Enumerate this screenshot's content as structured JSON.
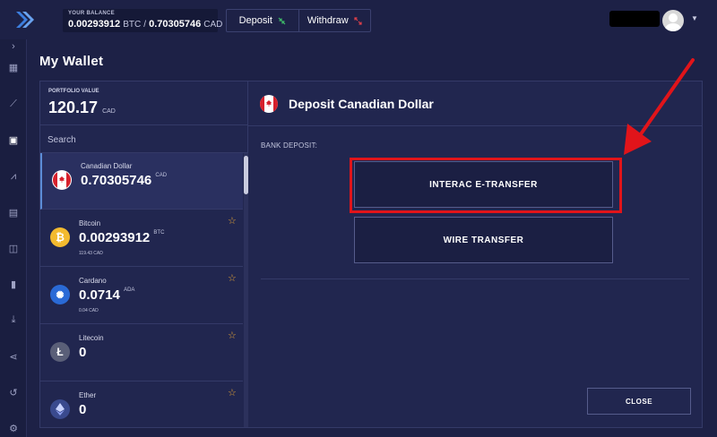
{
  "header": {
    "balance_caption": "YOUR BALANCE",
    "balance_btc": "0.00293912",
    "balance_btc_unit": "BTC",
    "balance_sep": "/",
    "balance_cad": "0.70305746",
    "balance_cad_unit": "CAD",
    "deposit_label": "Deposit",
    "withdraw_label": "Withdraw"
  },
  "page": {
    "title": "My Wallet"
  },
  "portfolio": {
    "caption": "PORTFOLIO VALUE",
    "value": "120.17",
    "unit": "CAD",
    "search_placeholder": "Search"
  },
  "wallets": [
    {
      "name": "Canadian Dollar",
      "balance": "0.70305746",
      "unit": "CAD",
      "sub": "",
      "coin_color": "#ffffff",
      "icon": "canada-flag-icon"
    },
    {
      "name": "Bitcoin",
      "balance": "0.00293912",
      "unit": "BTC",
      "sub": "119.43 CAD",
      "coin_color": "#f3ba2f",
      "icon": "bitcoin-icon"
    },
    {
      "name": "Cardano",
      "balance": "0.0714",
      "unit": "ADA",
      "sub": "0.04 CAD",
      "coin_color": "#2a6ad6",
      "icon": "cardano-icon"
    },
    {
      "name": "Litecoin",
      "balance": "0",
      "unit": "",
      "sub": "",
      "coin_color": "#5a5f78",
      "icon": "litecoin-icon"
    },
    {
      "name": "Ether",
      "balance": "0",
      "unit": "",
      "sub": "",
      "coin_color": "#3a4a8e",
      "icon": "ether-icon"
    }
  ],
  "deposit": {
    "title": "Deposit Canadian Dollar",
    "section_label": "BANK DEPOSIT:",
    "option_interac": "INTERAC E-TRANSFER",
    "option_wire": "WIRE TRANSFER",
    "close_label": "CLOSE"
  },
  "colors": {
    "background": "#1d2146",
    "panel": "#21264f",
    "highlight": "#e1141a",
    "star": "#e6a436"
  }
}
